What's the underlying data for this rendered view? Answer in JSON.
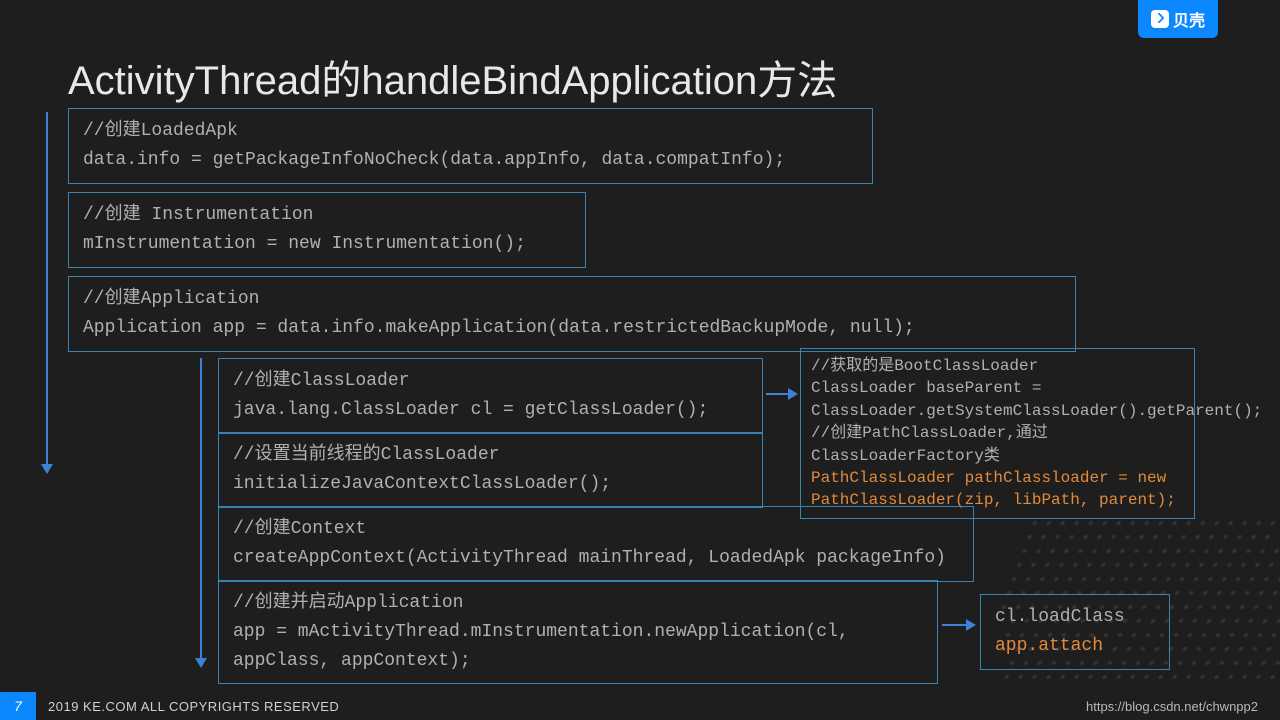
{
  "logo": {
    "text": "贝壳"
  },
  "title": "ActivityThread的handleBindApplication方法",
  "box1": {
    "l1": "//创建LoadedApk",
    "l2": "data.info = getPackageInfoNoCheck(data.appInfo, data.compatInfo);"
  },
  "box2": {
    "l1": "//创建 Instrumentation",
    "l2": "mInstrumentation = new Instrumentation();"
  },
  "box3": {
    "l1": "//创建Application",
    "l2": "Application app = data.info.makeApplication(data.restrictedBackupMode, null);"
  },
  "box4": {
    "l1": "//创建ClassLoader",
    "l2": "java.lang.ClassLoader cl = getClassLoader();"
  },
  "box5": {
    "l1": "//设置当前线程的ClassLoader",
    "l2": "initializeJavaContextClassLoader();"
  },
  "box6": {
    "l1": "//创建Context",
    "l2": "createAppContext(ActivityThread mainThread, LoadedApk packageInfo)"
  },
  "box7": {
    "l1": "//创建并启动Application",
    "l2": "app = mActivityThread.mInstrumentation.newApplication(cl, appClass, appContext);"
  },
  "box8": {
    "l1": "//获取的是BootClassLoader",
    "l2": "ClassLoader baseParent =",
    "l3": "ClassLoader.getSystemClassLoader().getParent();",
    "l4": "//创建PathClassLoader,通过ClassLoaderFactory类",
    "l5a": "PathClassLoader pathClassloader = new",
    "l5b": "PathClassLoader(zip, libPath, parent);"
  },
  "box9": {
    "l1": "cl.loadClass",
    "l2": "app.attach"
  },
  "footer": {
    "page": "7",
    "copyright": "2019 KE.COM ALL COPYRIGHTS RESERVED",
    "url": "https://blog.csdn.net/chwnpp2"
  }
}
